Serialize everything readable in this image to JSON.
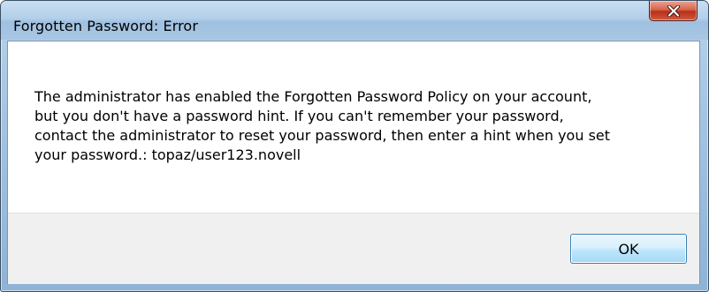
{
  "window": {
    "title": "Forgotten Password:  Error"
  },
  "titlebar": {
    "close_icon": "close-x-icon",
    "close_color": "#c7432a"
  },
  "dialog": {
    "message": "The administrator has enabled the Forgotten Password Policy on your account,\nbut you don't have a password hint.  If you can't remember your password,\ncontact the administrator to reset your password, then enter a hint when you set\nyour password.: topaz/user123.novell",
    "ok_label": "OK"
  }
}
